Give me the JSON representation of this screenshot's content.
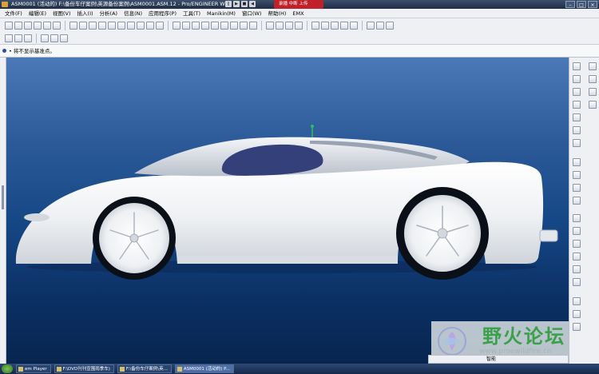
{
  "window": {
    "title": "ASM0001 (活动的) F:\\备份车仔案例\\英源备份案例\\ASM0001.ASM.12 - Pro/ENGINEER Wi",
    "recorder_label": "录播   中断 上传"
  },
  "menu": [
    "文件(F)",
    "编辑(E)",
    "视图(V)",
    "插入(I)",
    "分析(A)",
    "信息(N)",
    "应用程序(P)",
    "工具(T)",
    "Manikin(M)",
    "窗口(W)",
    "帮助(H)",
    "EMX"
  ],
  "message": "• 将不显示基准点。",
  "status": {
    "label": "智能"
  },
  "watermark": {
    "text": "野火论坛",
    "url": "www.proewildfire.cn"
  },
  "taskbar": {
    "items": [
      "em Player",
      "F:\\DVD刊刊宣围雨季车)",
      "F:\\备份车仔案例\\英...",
      "ASM0001 (活动的) P..."
    ]
  },
  "model": {
    "name": "sports-car assembly",
    "body_color": "#f2f3f5",
    "window_color": "#33407a"
  }
}
